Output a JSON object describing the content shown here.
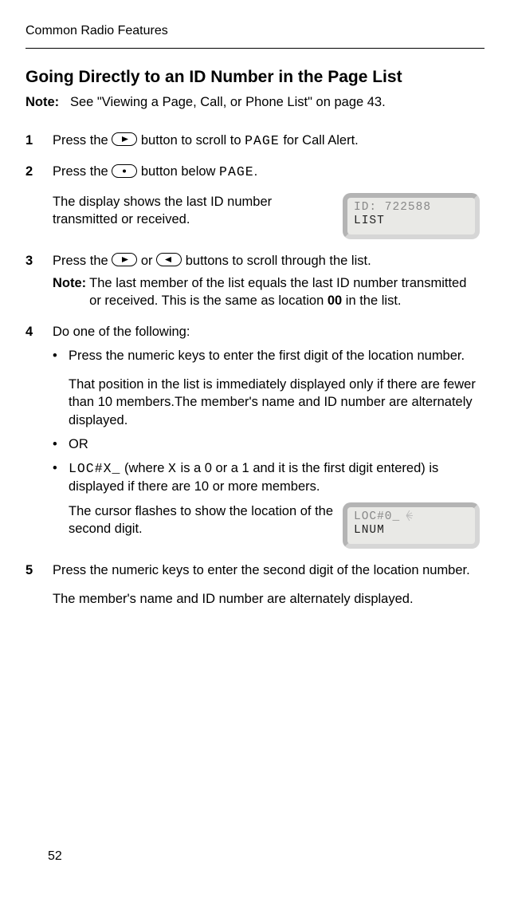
{
  "running_header": "Common Radio Features",
  "title": "Going Directly to an ID Number in the Page List",
  "note_label": "Note:",
  "note_body": "See \"Viewing a Page, Call, or Phone List\" on page 43.",
  "steps": {
    "s1": {
      "num": "1",
      "pre": "Press the ",
      "post": " button to scroll to ",
      "code": "PAGE",
      "tail": " for Call Alert."
    },
    "s2": {
      "num": "2",
      "pre": "Press the ",
      "post": " button below ",
      "code": "PAGE",
      "tail": ".",
      "result": "The display shows the last ID number transmitted or received.",
      "disp_l1": "ID: 722588",
      "disp_l2_dark": "LIST"
    },
    "s3": {
      "num": "3",
      "pre": "Press the ",
      "mid": " or ",
      "post": " buttons to scroll through the list.",
      "note_label": "Note:",
      "note_body_a": "The last member of the list equals the last ID number transmitted or received. This is the same as location ",
      "note_bold": "00",
      "note_body_b": " in the list."
    },
    "s4": {
      "num": "4",
      "lead": "Do one of the following:",
      "b1a": "Press the numeric keys to enter the first digit of the location number.",
      "b1b": "That position in the list is immediately displayed only if there are fewer than 10 members.The member's name and ID number are alternately displayed.",
      "b2": "OR",
      "b3_code": "LOC#X_",
      "b3_a": "  (where ",
      "b3_x": "X",
      "b3_b": " is a 0 or a 1 and it is the first digit entered) is displayed if there are 10 or more members.",
      "b3_result": "The cursor flashes to show the location of the second digit.",
      "disp_l1": "LOC#0_",
      "disp_l2_dark": "LNUM"
    },
    "s5": {
      "num": "5",
      "text": "Press the numeric keys to enter the second digit of the location number.",
      "result": "The member's name and ID number are alternately displayed."
    }
  },
  "page_number": "52"
}
